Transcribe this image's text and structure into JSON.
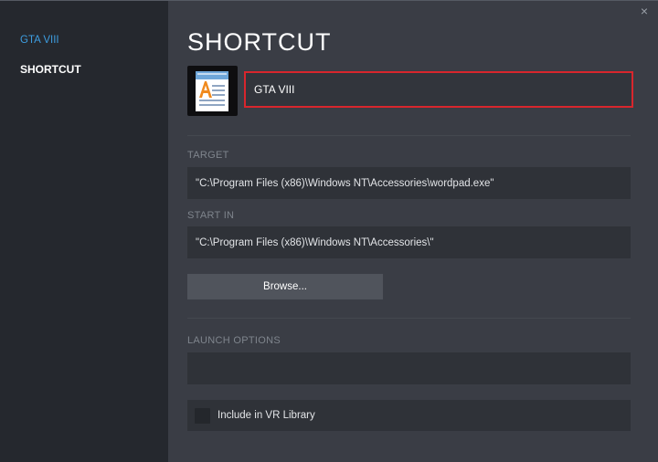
{
  "sidebar": {
    "game_label": "GTA VIII",
    "section_label": "SHORTCUT"
  },
  "close_glyph": "×",
  "main": {
    "title": "SHORTCUT",
    "app_icon": "wordpad-icon",
    "shortcut_name": "GTA VIII",
    "target_label": "TARGET",
    "target_value": "\"C:\\Program Files (x86)\\Windows NT\\Accessories\\wordpad.exe\"",
    "start_in_label": "START IN",
    "start_in_value": "\"C:\\Program Files (x86)\\Windows NT\\Accessories\\\"",
    "browse_label": "Browse...",
    "launch_options_label": "LAUNCH OPTIONS",
    "launch_options_value": "",
    "vr_label": "Include in VR Library",
    "vr_checked": false
  },
  "colors": {
    "accent_blue": "#3d9de0",
    "highlight_red": "#d8262d"
  }
}
